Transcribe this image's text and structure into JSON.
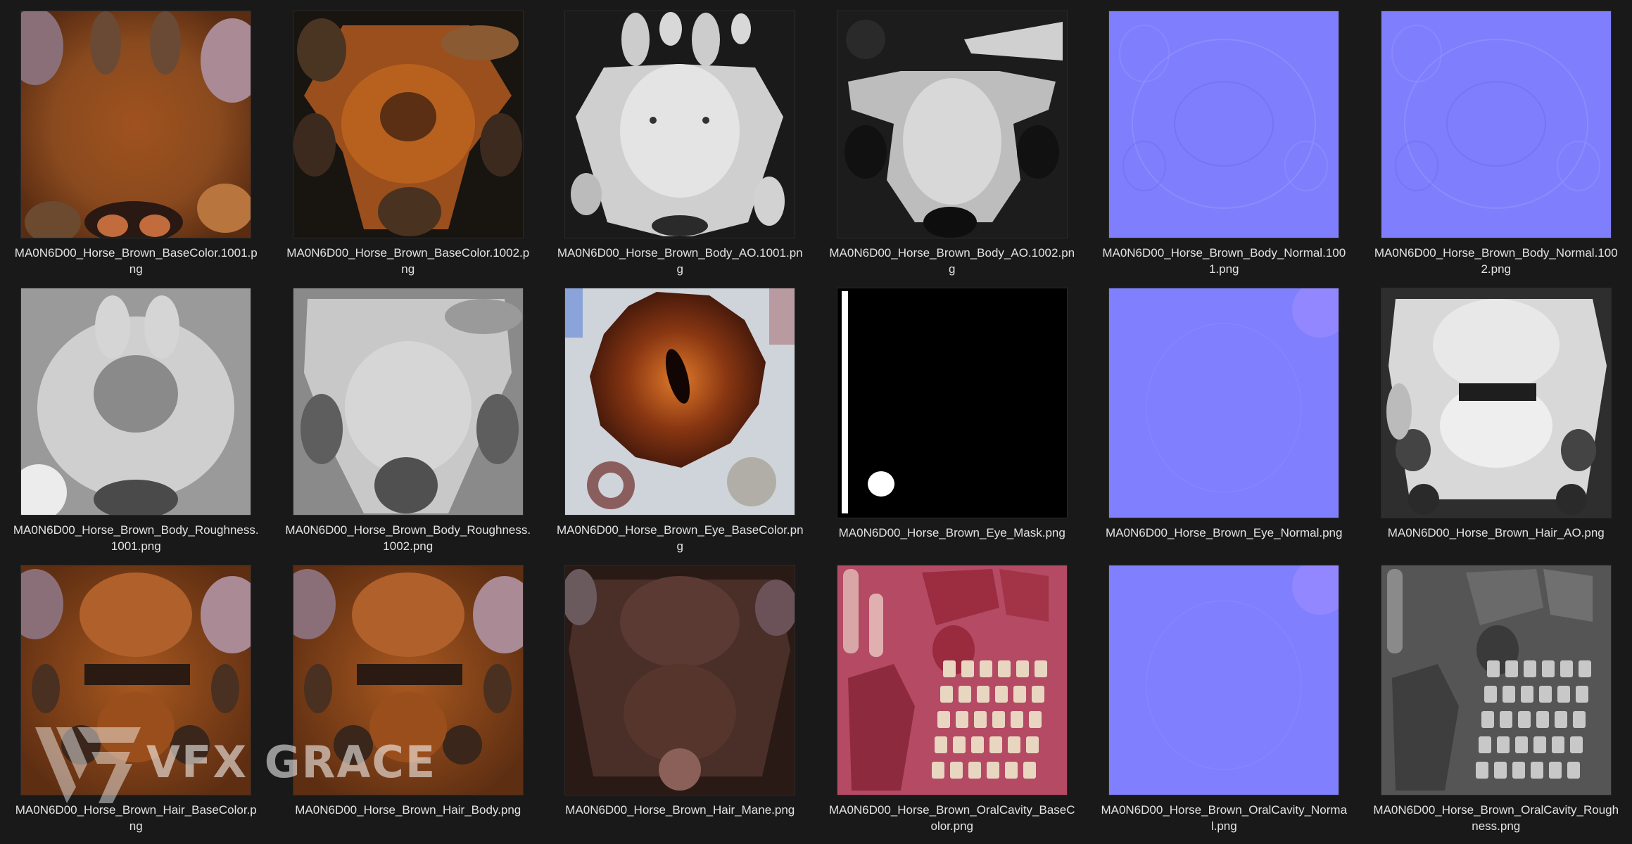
{
  "files": [
    {
      "name": "MA0N6D00_Horse_Brown_BaseColor.1001.png",
      "kind": "basecolor-a"
    },
    {
      "name": "MA0N6D00_Horse_Brown_BaseColor.1002.png",
      "kind": "basecolor-b"
    },
    {
      "name": "MA0N6D00_Horse_Brown_Body_AO.1001.png",
      "kind": "ao-a"
    },
    {
      "name": "MA0N6D00_Horse_Brown_Body_AO.1002.png",
      "kind": "ao-b"
    },
    {
      "name": "MA0N6D00_Horse_Brown_Body_Normal.1001.png",
      "kind": "normal"
    },
    {
      "name": "MA0N6D00_Horse_Brown_Body_Normal.1002.png",
      "kind": "normal"
    },
    {
      "name": "MA0N6D00_Horse_Brown_Body_Roughness.1001.png",
      "kind": "rough-a"
    },
    {
      "name": "MA0N6D00_Horse_Brown_Body_Roughness.1002.png",
      "kind": "rough-b"
    },
    {
      "name": "MA0N6D00_Horse_Brown_Eye_BaseColor.png",
      "kind": "eye"
    },
    {
      "name": "MA0N6D00_Horse_Brown_Eye_Mask.png",
      "kind": "mask"
    },
    {
      "name": "MA0N6D00_Horse_Brown_Eye_Normal.png",
      "kind": "normal-flat"
    },
    {
      "name": "MA0N6D00_Horse_Brown_Hair_AO.png",
      "kind": "hair-ao"
    },
    {
      "name": "MA0N6D00_Horse_Brown_Hair_BaseColor.png",
      "kind": "hair-base"
    },
    {
      "name": "MA0N6D00_Horse_Brown_Hair_Body.png",
      "kind": "hair-base"
    },
    {
      "name": "MA0N6D00_Horse_Brown_Hair_Mane.png",
      "kind": "mane"
    },
    {
      "name": "MA0N6D00_Horse_Brown_OralCavity_BaseColor.png",
      "kind": "oral"
    },
    {
      "name": "MA0N6D00_Horse_Brown_OralCavity_Normal.png",
      "kind": "normal-flat"
    },
    {
      "name": "MA0N6D00_Horse_Brown_OralCavity_Roughness.png",
      "kind": "oral-rough"
    }
  ],
  "watermark": {
    "text": "VFX GRACE"
  },
  "colors": {
    "background": "#191919",
    "label": "#e3e3e3",
    "normal_map": "#8080ff"
  }
}
